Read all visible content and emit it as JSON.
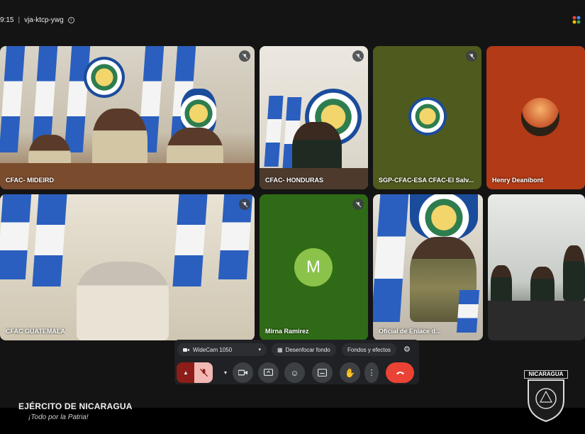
{
  "meeting": {
    "time": "9:15",
    "separator": "|",
    "code": "vja-ktcp-ywg"
  },
  "tiles": [
    {
      "name": "CFAC- MIDEIRD",
      "muted": true
    },
    {
      "name": "CFAC- HONDURAS",
      "muted": true
    },
    {
      "name": "SGP-CFAC-ESA CFAC-El Salv...",
      "muted": true
    },
    {
      "name": "Henry Deanibont",
      "muted": false
    },
    {
      "name": "CFAC GUATEMALA",
      "muted": true
    },
    {
      "name": "Mirna Ramirez",
      "muted": true,
      "avatar_letter": "M",
      "avatar_color": "#8bc34a"
    },
    {
      "name": "Oficial de Enlace d...",
      "muted": false
    },
    {
      "name": "",
      "muted": false
    }
  ],
  "controls": {
    "camera_label": "WideCam 1050",
    "blur_label": "Desenfocar fondo",
    "effects_label": "Fondos y efectos",
    "end_call_color": "#ea4335"
  },
  "overlay": {
    "brand": "EJÉRCITO DE NICARAGUA",
    "motto": "¡Todo por la Patria!",
    "emblem_label": "NICARAGUA"
  },
  "icons": [
    "info-icon",
    "google-dots-icon",
    "mic-off-icon",
    "video-camera-icon",
    "chevron-down-icon",
    "blur-icon",
    "sparkle-icon",
    "settings-icon",
    "mic-off-icon",
    "camera-icon",
    "present-icon",
    "emoji-icon",
    "captions-icon",
    "raise-hand-icon",
    "more-options-icon",
    "end-call-icon"
  ]
}
